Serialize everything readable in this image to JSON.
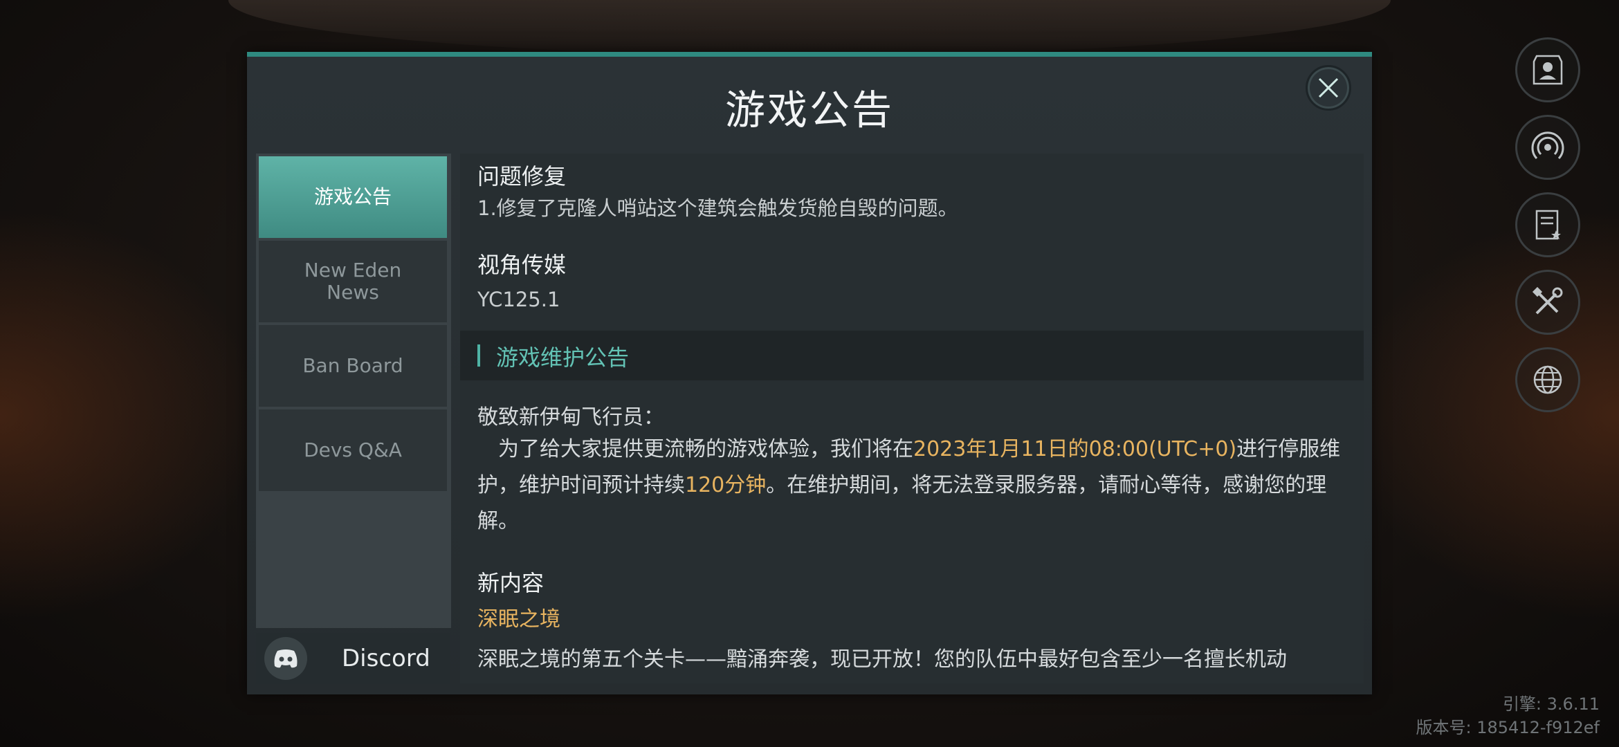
{
  "dialog": {
    "title": "游戏公告",
    "close_icon": "close-icon"
  },
  "sidebar": {
    "items": [
      {
        "label": "游戏公告",
        "active": true
      },
      {
        "label": "New Eden\nNews",
        "active": false
      },
      {
        "label": "Ban Board",
        "active": false
      },
      {
        "label": "Devs Q&A",
        "active": false
      }
    ],
    "discord": {
      "label": "Discord",
      "icon": "discord-icon"
    }
  },
  "content": {
    "bugfix_heading": "问题修复",
    "bugfix_item": "1.修复了克隆人哨站这个建筑会触发货舱自毁的问题。",
    "media_heading": "视角传媒",
    "media_version": "YC125.1",
    "maintenance_title": "游戏维护公告",
    "greeting": "敬致新伊甸飞行员：",
    "para_part1": "　为了给大家提供更流畅的游戏体验，我们将在",
    "para_time": "2023年1月11日的08:00(UTC+0)",
    "para_part2": "进行停服维护，维护时间预计持续",
    "para_duration": "120分钟",
    "para_part3": "。在维护期间，将无法登录服务器，请耐心等待，感谢您的理解。",
    "new_content_heading": "新内容",
    "deep_sleep_title": "深眠之境",
    "deep_sleep_text": "深眠之境的第五个关卡——黯涌奔袭，现已开放！您的队伍中最好包含至少一名擅长机动"
  },
  "right_icons": [
    "profile-icon",
    "signal-icon",
    "notes-icon",
    "tools-icon",
    "globe-icon"
  ],
  "version": {
    "engine": "引擎: 3.6.11",
    "build": "版本号: 185412-f912ef"
  },
  "colors": {
    "accent": "#2f8a80",
    "active_tab": "#4fa095",
    "highlight": "#e8b460",
    "maintenance_title": "#63c3b5"
  }
}
